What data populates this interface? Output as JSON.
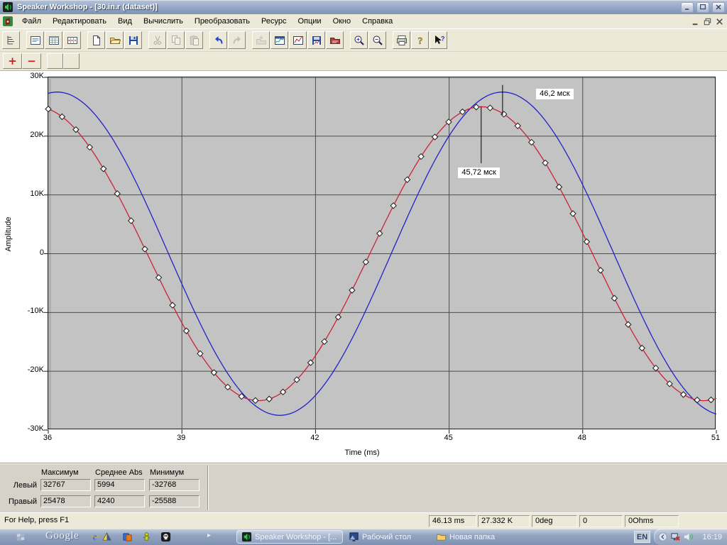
{
  "window": {
    "title": "Speaker Workshop - [30.in.r (dataset)]"
  },
  "menu": {
    "items": [
      "Файл",
      "Редактировать",
      "Вид",
      "Вычислить",
      "Преобразовать",
      "Ресурс",
      "Опции",
      "Окно",
      "Справка"
    ]
  },
  "toolbar": {
    "icons": [
      "tree-view",
      "view-notes",
      "view-datasheet",
      "view-columns",
      "new-document",
      "open-folder",
      "save",
      "cut",
      "copy",
      "paste",
      "undo",
      "redo",
      "import-folder",
      "chart-window",
      "chart-line",
      "save-chart",
      "export-chart",
      "zoom-in",
      "zoom-out",
      "print",
      "help",
      "context-help"
    ],
    "add_glyph": "+",
    "remove_glyph": "−"
  },
  "chart_data": {
    "type": "line",
    "title": "",
    "xlabel": "Time (ms)",
    "ylabel": "Amplitude",
    "xlim": [
      36,
      51
    ],
    "ylim": [
      -30000,
      30000
    ],
    "xticks": [
      36,
      39,
      42,
      45,
      48,
      51
    ],
    "yticks": [
      {
        "value": 30000,
        "label": "30K"
      },
      {
        "value": 20000,
        "label": "20K"
      },
      {
        "value": 10000,
        "label": "10K"
      },
      {
        "value": 0,
        "label": "0"
      },
      {
        "value": -10000,
        "label": "-10K"
      },
      {
        "value": -20000,
        "label": "-20K"
      },
      {
        "value": -30000,
        "label": "-30K"
      }
    ],
    "grid": true,
    "plot_bg": "#c3c3c3",
    "series": [
      {
        "name": "left-channel",
        "color": "#2222c8",
        "waveform": "sine",
        "amplitude": 27500,
        "period_ms": 10,
        "peak_ms": 46.2,
        "markers": false
      },
      {
        "name": "right-channel",
        "color": "#cc2238",
        "waveform": "sine",
        "amplitude": 25000,
        "period_ms": 10,
        "peak_ms": 45.72,
        "markers": true,
        "marker_step_ms": 0.31
      }
    ],
    "annotations": [
      {
        "label": "46,2 мск",
        "x_ms": 46.2,
        "line_from": 28700,
        "line_to": 23600,
        "label_x_ms": 46.97,
        "label_value": 27900
      },
      {
        "label": "45,72 мск",
        "x_ms": 45.72,
        "line_from": 25000,
        "line_to": 15400,
        "label_x_ms": 45.22,
        "label_value": 14500
      }
    ]
  },
  "stats": {
    "headers": [
      "Максимум",
      "Среднее Abs",
      "Минимум"
    ],
    "rows": [
      {
        "label": "Левый",
        "values": [
          "32767",
          "5994",
          "-32768"
        ]
      },
      {
        "label": "Правый",
        "values": [
          "25478",
          "4240",
          "-25588"
        ]
      }
    ]
  },
  "statusbar": {
    "message": "For Help, press F1",
    "panels": [
      "46.13  ms",
      "27.332 K",
      "0deg",
      "0",
      "0Ohms"
    ]
  },
  "taskbar": {
    "google_label": "Google",
    "quick_launch": [
      "windows-flag",
      "internet-explorer",
      "delphi",
      "cards-app",
      "robot-app",
      "skull-app"
    ],
    "buttons": [
      {
        "label": "Speaker Workshop - [...",
        "icon": "speaker",
        "active": true
      },
      {
        "label": "Рабочий стол",
        "icon": "desktop",
        "active": false
      },
      {
        "label": "Новая папка",
        "icon": "folder",
        "active": false
      }
    ],
    "tray": {
      "lang": "EN",
      "icons": [
        "collapse-arrow",
        "network-offline",
        "volume"
      ],
      "clock": "16:19"
    }
  }
}
